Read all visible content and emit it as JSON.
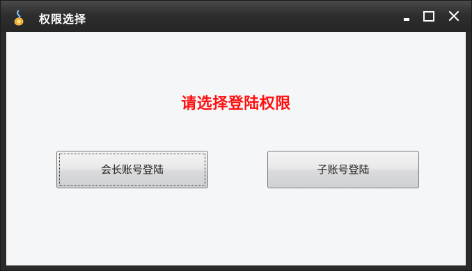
{
  "window": {
    "title": "权限选择",
    "icons": {
      "app": "app-logo-icon",
      "minimize": "minimize-icon",
      "maximize": "maximize-icon",
      "close": "close-icon"
    }
  },
  "main": {
    "prompt": "请选择登陆权限",
    "prompt_color": "#ff1010",
    "buttons": [
      {
        "label": "会长账号登陆",
        "focused": true
      },
      {
        "label": "子账号登陆",
        "focused": false
      }
    ]
  }
}
